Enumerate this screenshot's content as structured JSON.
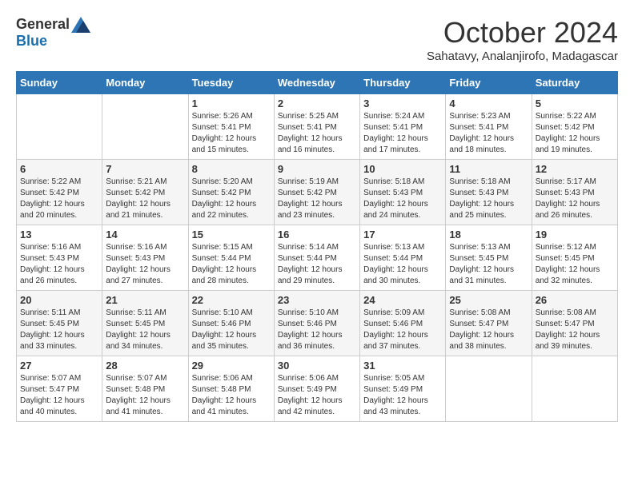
{
  "logo": {
    "general": "General",
    "blue": "Blue"
  },
  "title": "October 2024",
  "subtitle": "Sahatavy, Analanjirofo, Madagascar",
  "days_of_week": [
    "Sunday",
    "Monday",
    "Tuesday",
    "Wednesday",
    "Thursday",
    "Friday",
    "Saturday"
  ],
  "weeks": [
    [
      {
        "day": "",
        "sunrise": "",
        "sunset": "",
        "daylight": ""
      },
      {
        "day": "",
        "sunrise": "",
        "sunset": "",
        "daylight": ""
      },
      {
        "day": "1",
        "sunrise": "Sunrise: 5:26 AM",
        "sunset": "Sunset: 5:41 PM",
        "daylight": "Daylight: 12 hours and 15 minutes."
      },
      {
        "day": "2",
        "sunrise": "Sunrise: 5:25 AM",
        "sunset": "Sunset: 5:41 PM",
        "daylight": "Daylight: 12 hours and 16 minutes."
      },
      {
        "day": "3",
        "sunrise": "Sunrise: 5:24 AM",
        "sunset": "Sunset: 5:41 PM",
        "daylight": "Daylight: 12 hours and 17 minutes."
      },
      {
        "day": "4",
        "sunrise": "Sunrise: 5:23 AM",
        "sunset": "Sunset: 5:41 PM",
        "daylight": "Daylight: 12 hours and 18 minutes."
      },
      {
        "day": "5",
        "sunrise": "Sunrise: 5:22 AM",
        "sunset": "Sunset: 5:42 PM",
        "daylight": "Daylight: 12 hours and 19 minutes."
      }
    ],
    [
      {
        "day": "6",
        "sunrise": "Sunrise: 5:22 AM",
        "sunset": "Sunset: 5:42 PM",
        "daylight": "Daylight: 12 hours and 20 minutes."
      },
      {
        "day": "7",
        "sunrise": "Sunrise: 5:21 AM",
        "sunset": "Sunset: 5:42 PM",
        "daylight": "Daylight: 12 hours and 21 minutes."
      },
      {
        "day": "8",
        "sunrise": "Sunrise: 5:20 AM",
        "sunset": "Sunset: 5:42 PM",
        "daylight": "Daylight: 12 hours and 22 minutes."
      },
      {
        "day": "9",
        "sunrise": "Sunrise: 5:19 AM",
        "sunset": "Sunset: 5:42 PM",
        "daylight": "Daylight: 12 hours and 23 minutes."
      },
      {
        "day": "10",
        "sunrise": "Sunrise: 5:18 AM",
        "sunset": "Sunset: 5:43 PM",
        "daylight": "Daylight: 12 hours and 24 minutes."
      },
      {
        "day": "11",
        "sunrise": "Sunrise: 5:18 AM",
        "sunset": "Sunset: 5:43 PM",
        "daylight": "Daylight: 12 hours and 25 minutes."
      },
      {
        "day": "12",
        "sunrise": "Sunrise: 5:17 AM",
        "sunset": "Sunset: 5:43 PM",
        "daylight": "Daylight: 12 hours and 26 minutes."
      }
    ],
    [
      {
        "day": "13",
        "sunrise": "Sunrise: 5:16 AM",
        "sunset": "Sunset: 5:43 PM",
        "daylight": "Daylight: 12 hours and 26 minutes."
      },
      {
        "day": "14",
        "sunrise": "Sunrise: 5:16 AM",
        "sunset": "Sunset: 5:43 PM",
        "daylight": "Daylight: 12 hours and 27 minutes."
      },
      {
        "day": "15",
        "sunrise": "Sunrise: 5:15 AM",
        "sunset": "Sunset: 5:44 PM",
        "daylight": "Daylight: 12 hours and 28 minutes."
      },
      {
        "day": "16",
        "sunrise": "Sunrise: 5:14 AM",
        "sunset": "Sunset: 5:44 PM",
        "daylight": "Daylight: 12 hours and 29 minutes."
      },
      {
        "day": "17",
        "sunrise": "Sunrise: 5:13 AM",
        "sunset": "Sunset: 5:44 PM",
        "daylight": "Daylight: 12 hours and 30 minutes."
      },
      {
        "day": "18",
        "sunrise": "Sunrise: 5:13 AM",
        "sunset": "Sunset: 5:45 PM",
        "daylight": "Daylight: 12 hours and 31 minutes."
      },
      {
        "day": "19",
        "sunrise": "Sunrise: 5:12 AM",
        "sunset": "Sunset: 5:45 PM",
        "daylight": "Daylight: 12 hours and 32 minutes."
      }
    ],
    [
      {
        "day": "20",
        "sunrise": "Sunrise: 5:11 AM",
        "sunset": "Sunset: 5:45 PM",
        "daylight": "Daylight: 12 hours and 33 minutes."
      },
      {
        "day": "21",
        "sunrise": "Sunrise: 5:11 AM",
        "sunset": "Sunset: 5:45 PM",
        "daylight": "Daylight: 12 hours and 34 minutes."
      },
      {
        "day": "22",
        "sunrise": "Sunrise: 5:10 AM",
        "sunset": "Sunset: 5:46 PM",
        "daylight": "Daylight: 12 hours and 35 minutes."
      },
      {
        "day": "23",
        "sunrise": "Sunrise: 5:10 AM",
        "sunset": "Sunset: 5:46 PM",
        "daylight": "Daylight: 12 hours and 36 minutes."
      },
      {
        "day": "24",
        "sunrise": "Sunrise: 5:09 AM",
        "sunset": "Sunset: 5:46 PM",
        "daylight": "Daylight: 12 hours and 37 minutes."
      },
      {
        "day": "25",
        "sunrise": "Sunrise: 5:08 AM",
        "sunset": "Sunset: 5:47 PM",
        "daylight": "Daylight: 12 hours and 38 minutes."
      },
      {
        "day": "26",
        "sunrise": "Sunrise: 5:08 AM",
        "sunset": "Sunset: 5:47 PM",
        "daylight": "Daylight: 12 hours and 39 minutes."
      }
    ],
    [
      {
        "day": "27",
        "sunrise": "Sunrise: 5:07 AM",
        "sunset": "Sunset: 5:47 PM",
        "daylight": "Daylight: 12 hours and 40 minutes."
      },
      {
        "day": "28",
        "sunrise": "Sunrise: 5:07 AM",
        "sunset": "Sunset: 5:48 PM",
        "daylight": "Daylight: 12 hours and 41 minutes."
      },
      {
        "day": "29",
        "sunrise": "Sunrise: 5:06 AM",
        "sunset": "Sunset: 5:48 PM",
        "daylight": "Daylight: 12 hours and 41 minutes."
      },
      {
        "day": "30",
        "sunrise": "Sunrise: 5:06 AM",
        "sunset": "Sunset: 5:49 PM",
        "daylight": "Daylight: 12 hours and 42 minutes."
      },
      {
        "day": "31",
        "sunrise": "Sunrise: 5:05 AM",
        "sunset": "Sunset: 5:49 PM",
        "daylight": "Daylight: 12 hours and 43 minutes."
      },
      {
        "day": "",
        "sunrise": "",
        "sunset": "",
        "daylight": ""
      },
      {
        "day": "",
        "sunrise": "",
        "sunset": "",
        "daylight": ""
      }
    ]
  ]
}
